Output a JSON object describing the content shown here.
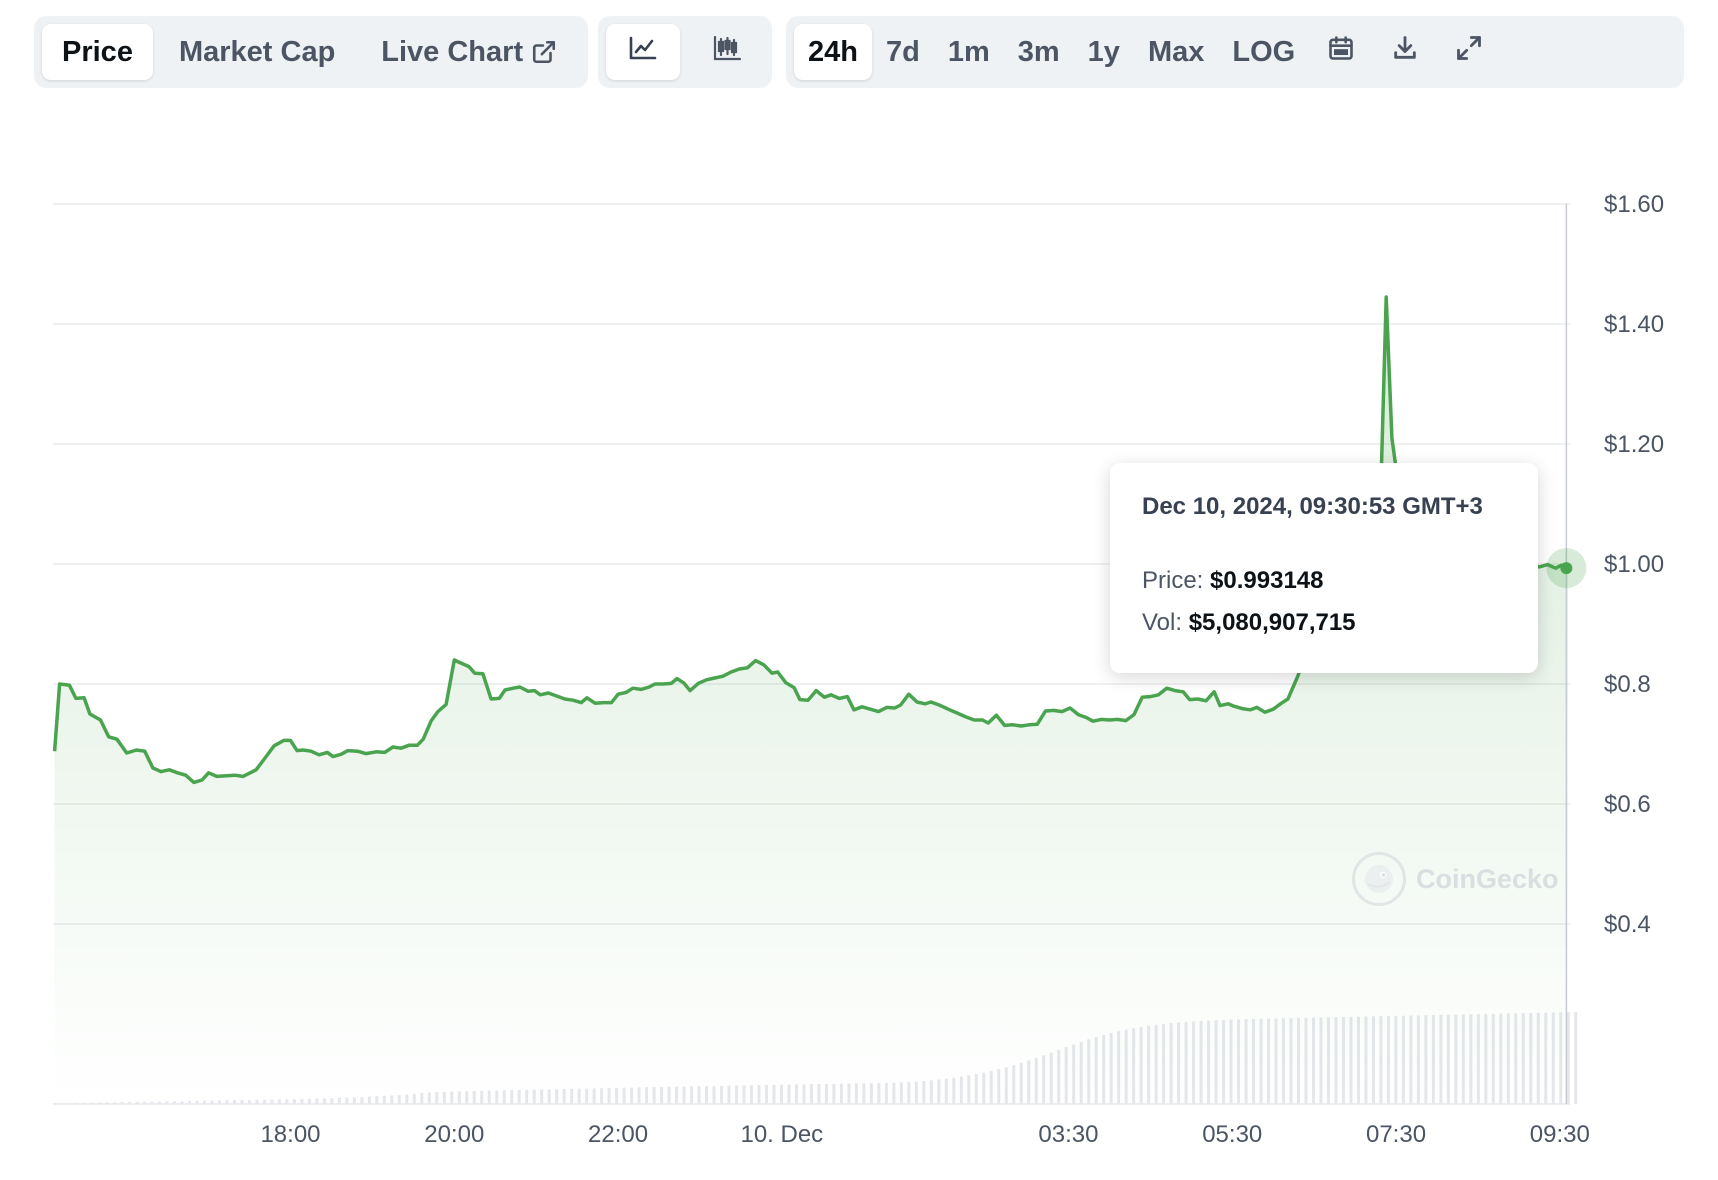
{
  "toolbar": {
    "metric_tabs": [
      {
        "label": "Price",
        "active": true
      },
      {
        "label": "Market Cap",
        "active": false
      },
      {
        "label": "Live Chart",
        "active": false,
        "icon": "external-link-icon"
      }
    ],
    "chart_types": [
      {
        "icon": "line-chart-icon",
        "active": true
      },
      {
        "icon": "candlestick-icon",
        "active": false
      }
    ],
    "ranges": [
      {
        "label": "24h",
        "active": true
      },
      {
        "label": "7d",
        "active": false
      },
      {
        "label": "1m",
        "active": false
      },
      {
        "label": "3m",
        "active": false
      },
      {
        "label": "1y",
        "active": false
      },
      {
        "label": "Max",
        "active": false
      },
      {
        "label": "LOG",
        "active": false
      }
    ],
    "actions": [
      "calendar-icon",
      "download-icon",
      "expand-icon"
    ]
  },
  "tooltip": {
    "date": "Dec 10, 2024, 09:30:53 GMT+3",
    "price_label": "Price:",
    "price_value": "$0.993148",
    "vol_label": "Vol:",
    "vol_value": "$5,080,907,715"
  },
  "watermark": {
    "text": "CoinGecko"
  },
  "colors": {
    "line": "#4aa44f",
    "fill": "#4aa44f",
    "grid": "#e5e7eb",
    "volume": "#e5e7eb",
    "axis_text": "#4b5563"
  },
  "chart_data": {
    "type": "line",
    "title": "",
    "xlabel": "",
    "ylabel": "",
    "y_ticks": [
      "$0.4",
      "$0.6",
      "$0.8",
      "$1.00",
      "$1.20",
      "$1.40",
      "$1.60"
    ],
    "y_tick_values": [
      0.4,
      0.6,
      0.8,
      1.0,
      1.2,
      1.4,
      1.6
    ],
    "ylim": [
      0.4,
      1.6
    ],
    "x_ticks": [
      "18:00",
      "20:00",
      "22:00",
      "10. Dec",
      "03:30",
      "05:30",
      "07:30",
      "09:30"
    ],
    "x_tick_hours": [
      18,
      20,
      22,
      24,
      27.5,
      29.5,
      31.5,
      33.5
    ],
    "xlim_hours": [
      15.1,
      33.6
    ],
    "grid": true,
    "series": [
      {
        "values": [
          [
            15.12,
            0.688
          ],
          [
            15.18,
            0.8
          ],
          [
            15.3,
            0.798
          ],
          [
            15.38,
            0.776
          ],
          [
            15.48,
            0.777
          ],
          [
            15.55,
            0.75
          ],
          [
            15.68,
            0.74
          ],
          [
            15.78,
            0.712
          ],
          [
            15.88,
            0.708
          ],
          [
            16.0,
            0.685
          ],
          [
            16.12,
            0.69
          ],
          [
            16.22,
            0.688
          ],
          [
            16.32,
            0.66
          ],
          [
            16.42,
            0.654
          ],
          [
            16.52,
            0.657
          ],
          [
            16.62,
            0.652
          ],
          [
            16.72,
            0.648
          ],
          [
            16.82,
            0.636
          ],
          [
            16.92,
            0.64
          ],
          [
            17.0,
            0.652
          ],
          [
            17.1,
            0.646
          ],
          [
            17.22,
            0.647
          ],
          [
            17.32,
            0.648
          ],
          [
            17.42,
            0.646
          ],
          [
            17.58,
            0.657
          ],
          [
            17.68,
            0.675
          ],
          [
            17.8,
            0.697
          ],
          [
            17.92,
            0.706
          ],
          [
            18.0,
            0.706
          ],
          [
            18.08,
            0.689
          ],
          [
            18.15,
            0.69
          ],
          [
            18.25,
            0.688
          ],
          [
            18.35,
            0.682
          ],
          [
            18.45,
            0.686
          ],
          [
            18.52,
            0.679
          ],
          [
            18.62,
            0.683
          ],
          [
            18.7,
            0.689
          ],
          [
            18.82,
            0.688
          ],
          [
            18.92,
            0.684
          ],
          [
            19.05,
            0.687
          ],
          [
            19.15,
            0.686
          ],
          [
            19.25,
            0.695
          ],
          [
            19.35,
            0.693
          ],
          [
            19.45,
            0.698
          ],
          [
            19.55,
            0.698
          ],
          [
            19.62,
            0.708
          ],
          [
            19.72,
            0.739
          ],
          [
            19.8,
            0.754
          ],
          [
            19.9,
            0.766
          ],
          [
            20.0,
            0.84
          ],
          [
            20.08,
            0.835
          ],
          [
            20.18,
            0.829
          ],
          [
            20.25,
            0.818
          ],
          [
            20.35,
            0.817
          ],
          [
            20.45,
            0.775
          ],
          [
            20.55,
            0.776
          ],
          [
            20.62,
            0.79
          ],
          [
            20.72,
            0.793
          ],
          [
            20.8,
            0.795
          ],
          [
            20.9,
            0.788
          ],
          [
            20.98,
            0.789
          ],
          [
            21.05,
            0.782
          ],
          [
            21.15,
            0.785
          ],
          [
            21.25,
            0.78
          ],
          [
            21.35,
            0.775
          ],
          [
            21.45,
            0.773
          ],
          [
            21.55,
            0.769
          ],
          [
            21.62,
            0.777
          ],
          [
            21.72,
            0.768
          ],
          [
            21.82,
            0.769
          ],
          [
            21.92,
            0.769
          ],
          [
            22.0,
            0.783
          ],
          [
            22.1,
            0.786
          ],
          [
            22.18,
            0.793
          ],
          [
            22.28,
            0.791
          ],
          [
            22.38,
            0.795
          ],
          [
            22.45,
            0.8
          ],
          [
            22.55,
            0.8
          ],
          [
            22.65,
            0.801
          ],
          [
            22.72,
            0.809
          ],
          [
            22.8,
            0.802
          ],
          [
            22.88,
            0.789
          ],
          [
            22.98,
            0.801
          ],
          [
            23.08,
            0.807
          ],
          [
            23.18,
            0.81
          ],
          [
            23.28,
            0.813
          ],
          [
            23.38,
            0.82
          ],
          [
            23.48,
            0.825
          ],
          [
            23.58,
            0.827
          ],
          [
            23.68,
            0.839
          ],
          [
            23.78,
            0.832
          ],
          [
            23.88,
            0.818
          ],
          [
            23.95,
            0.82
          ],
          [
            24.05,
            0.802
          ],
          [
            24.15,
            0.794
          ],
          [
            24.22,
            0.774
          ],
          [
            24.32,
            0.773
          ],
          [
            24.42,
            0.789
          ],
          [
            24.52,
            0.778
          ],
          [
            24.6,
            0.782
          ],
          [
            24.7,
            0.776
          ],
          [
            24.8,
            0.779
          ],
          [
            24.88,
            0.757
          ],
          [
            24.98,
            0.762
          ],
          [
            25.08,
            0.758
          ],
          [
            25.18,
            0.754
          ],
          [
            25.28,
            0.761
          ],
          [
            25.38,
            0.76
          ],
          [
            25.45,
            0.765
          ],
          [
            25.55,
            0.783
          ],
          [
            25.65,
            0.77
          ],
          [
            25.75,
            0.767
          ],
          [
            25.82,
            0.77
          ],
          [
            25.92,
            0.765
          ],
          [
            26.05,
            0.757
          ],
          [
            26.15,
            0.751
          ],
          [
            26.25,
            0.745
          ],
          [
            26.35,
            0.74
          ],
          [
            26.45,
            0.74
          ],
          [
            26.52,
            0.735
          ],
          [
            26.62,
            0.748
          ],
          [
            26.72,
            0.731
          ],
          [
            26.82,
            0.732
          ],
          [
            26.92,
            0.73
          ],
          [
            27.02,
            0.732
          ],
          [
            27.12,
            0.733
          ],
          [
            27.22,
            0.755
          ],
          [
            27.32,
            0.756
          ],
          [
            27.42,
            0.754
          ],
          [
            27.52,
            0.76
          ],
          [
            27.62,
            0.749
          ],
          [
            27.72,
            0.744
          ],
          [
            27.8,
            0.738
          ],
          [
            27.9,
            0.741
          ],
          [
            28.0,
            0.74
          ],
          [
            28.1,
            0.741
          ],
          [
            28.2,
            0.739
          ],
          [
            28.3,
            0.749
          ],
          [
            28.4,
            0.778
          ],
          [
            28.5,
            0.779
          ],
          [
            28.6,
            0.782
          ],
          [
            28.7,
            0.793
          ],
          [
            28.8,
            0.789
          ],
          [
            28.9,
            0.787
          ],
          [
            28.98,
            0.774
          ],
          [
            29.08,
            0.775
          ],
          [
            29.18,
            0.772
          ],
          [
            29.28,
            0.787
          ],
          [
            29.35,
            0.764
          ],
          [
            29.45,
            0.767
          ],
          [
            29.52,
            0.763
          ],
          [
            29.62,
            0.759
          ],
          [
            29.72,
            0.757
          ],
          [
            29.8,
            0.761
          ],
          [
            29.9,
            0.753
          ],
          [
            30.0,
            0.758
          ],
          [
            30.1,
            0.768
          ],
          [
            30.18,
            0.775
          ],
          [
            30.3,
            0.813
          ],
          [
            30.42,
            0.86
          ],
          [
            30.55,
            0.935
          ],
          [
            30.65,
            0.958
          ],
          [
            30.75,
            0.967
          ],
          [
            30.85,
            0.975
          ],
          [
            30.95,
            0.982
          ],
          [
            31.05,
            0.988
          ],
          [
            31.15,
            0.995
          ],
          [
            31.25,
            1.0
          ],
          [
            31.3,
            1.05
          ],
          [
            31.38,
            1.445
          ],
          [
            31.45,
            1.21
          ],
          [
            31.55,
            1.11
          ],
          [
            31.62,
            1.08
          ],
          [
            31.72,
            1.05
          ],
          [
            31.8,
            1.04
          ],
          [
            31.9,
            1.03
          ],
          [
            32.0,
            1.028
          ],
          [
            32.1,
            1.03
          ],
          [
            32.2,
            1.02
          ],
          [
            32.3,
            1.028
          ],
          [
            32.4,
            1.022
          ],
          [
            32.5,
            1.018
          ],
          [
            32.6,
            1.025
          ],
          [
            32.7,
            1.02
          ],
          [
            32.78,
            1.015
          ],
          [
            32.88,
            1.018
          ],
          [
            32.95,
            1.015
          ],
          [
            33.05,
            1.01
          ],
          [
            33.15,
            1.0
          ],
          [
            33.25,
            0.995
          ],
          [
            33.35,
            0.999
          ],
          [
            33.45,
            0.993
          ],
          [
            33.52,
            0.998
          ],
          [
            33.6,
            0.993
          ]
        ]
      }
    ],
    "volume": {
      "start_hour": 15.12,
      "step_hours": 0.0915,
      "values": [
        0.4,
        0.5,
        0.6,
        0.7,
        0.8,
        0.9,
        1.0,
        1.1,
        1.1,
        1.2,
        1.3,
        1.3,
        1.4,
        1.5,
        1.5,
        1.6,
        1.6,
        1.7,
        1.8,
        1.9,
        2.0,
        2.1,
        2.2,
        2.3,
        2.4,
        2.5,
        2.5,
        2.6,
        2.6,
        2.7,
        2.8,
        2.9,
        3.0,
        3.1,
        3.3,
        3.4,
        3.5,
        3.6,
        3.8,
        3.9,
        4.0,
        4.2,
        4.5,
        4.8,
        5.0,
        5.2,
        5.6,
        5.9,
        6.3,
        6.8,
        7.1,
        7.3,
        7.5,
        7.6,
        7.8,
        7.8,
        8.0,
        8.1,
        8.2,
        8.3,
        8.4,
        8.5,
        8.6,
        8.7,
        8.8,
        8.9,
        9.0,
        9.1,
        9.2,
        9.3,
        9.4,
        9.5,
        9.6,
        9.7,
        9.8,
        9.9,
        10.0,
        10.1,
        10.2,
        10.3,
        10.4,
        10.5,
        10.6,
        10.7,
        10.8,
        10.9,
        11.0,
        11.0,
        11.1,
        11.2,
        11.3,
        11.4,
        11.5,
        11.6,
        11.7,
        11.7,
        11.8,
        11.9,
        12.0,
        12.1,
        12.1,
        12.2,
        12.3,
        12.4,
        12.4,
        12.5,
        12.6,
        12.6,
        12.7,
        12.8,
        12.9,
        13.0,
        13.1,
        13.3,
        13.5,
        13.8,
        14.2,
        14.6,
        15.1,
        15.6,
        16.2,
        16.9,
        17.6,
        18.4,
        19.3,
        20.3,
        21.4,
        22.6,
        23.9,
        25.3,
        26.8,
        28.4,
        30.0,
        31.6,
        33.3,
        35.0,
        36.6,
        38.2,
        39.8,
        41.2,
        42.5,
        43.7,
        44.8,
        45.8,
        46.6,
        47.4,
        48.1,
        48.7,
        49.2,
        49.7,
        50.1,
        50.5,
        50.8,
        51.1,
        51.3,
        51.5,
        51.7,
        51.9,
        52.0,
        52.2,
        52.3,
        52.4,
        52.5,
        52.6,
        52.7,
        52.8,
        52.9,
        53.0,
        53.1,
        53.2,
        53.3,
        53.4,
        53.5,
        53.6,
        53.7,
        53.8,
        53.9,
        54.0,
        54.1,
        54.2,
        54.3,
        54.4,
        54.5,
        54.6,
        54.7,
        54.8,
        54.9,
        55.0,
        55.1,
        55.2,
        55.3,
        55.4,
        55.5,
        55.6,
        55.7,
        55.8,
        55.9,
        56.0,
        56.1,
        56.2,
        56.3,
        56.4,
        56.5,
        56.6
      ]
    },
    "selected_point": {
      "hour": 33.58,
      "value": 0.993148
    }
  }
}
